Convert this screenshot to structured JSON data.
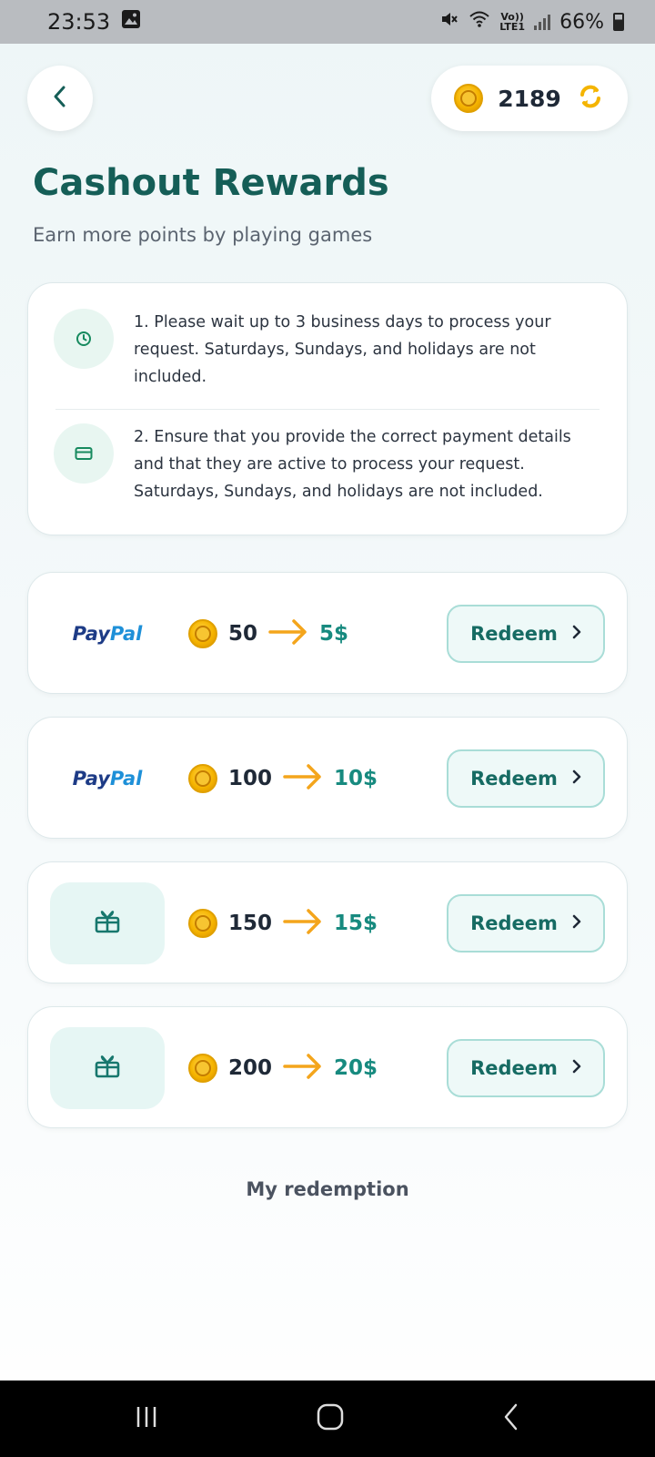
{
  "status_bar": {
    "time": "23:53",
    "battery": "66%",
    "network_top": "Vo))",
    "network_bottom": "LTE1"
  },
  "header": {
    "coin_balance": "2189"
  },
  "page": {
    "title": "Cashout Rewards",
    "subtitle": "Earn more points by playing games"
  },
  "info": {
    "items": [
      {
        "icon": "clock-icon",
        "text": "1. Please wait up to 3 business days to process your request. Saturdays, Sundays, and holidays are not included."
      },
      {
        "icon": "credit-card-icon",
        "text": "2. Ensure that you provide the correct payment details and that they are active to process your request. Saturdays, Sundays, and holidays are not included."
      }
    ]
  },
  "rewards": [
    {
      "method": "paypal",
      "brand_part1": "Pay",
      "brand_part2": "Pal",
      "points": "50",
      "cash": "5$",
      "button": "Redeem"
    },
    {
      "method": "paypal",
      "brand_part1": "Pay",
      "brand_part2": "Pal",
      "points": "100",
      "cash": "10$",
      "button": "Redeem"
    },
    {
      "method": "gift",
      "icon": "gift-card-icon",
      "points": "150",
      "cash": "15$",
      "button": "Redeem"
    },
    {
      "method": "gift",
      "icon": "gift-card-icon",
      "points": "200",
      "cash": "20$",
      "button": "Redeem"
    }
  ],
  "footer": {
    "my_redemption": "My redemption"
  },
  "colors": {
    "primary": "#155e57",
    "accent": "#178a7f",
    "arrow": "#f4a51c",
    "coin": "#f5b400"
  }
}
